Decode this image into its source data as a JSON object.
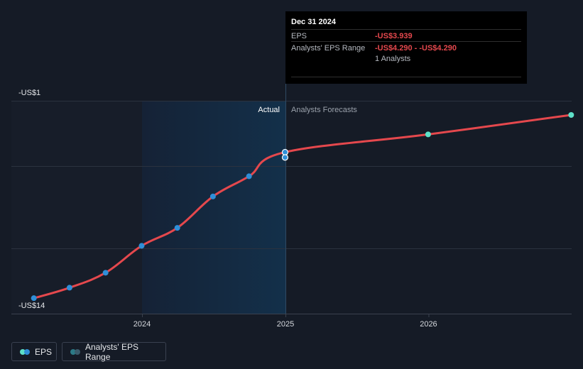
{
  "tooltip": {
    "date": "Dec 31 2024",
    "eps_label": "EPS",
    "eps_value": "-US$3.939",
    "range_label": "Analysts' EPS Range",
    "range_value": "-US$4.290 - -US$4.290",
    "analysts": "1 Analysts"
  },
  "legend": {
    "eps_label": "EPS",
    "range_label": "Analysts' EPS Range"
  },
  "colors": {
    "line": "#e5484d",
    "actual_point": "#2f8fd8",
    "forecast_point": "#5ee0c8",
    "range_dot_a": "#2c7a86",
    "range_dot_b": "#3a5b6b"
  },
  "chart_data": {
    "type": "line",
    "y_top_label": "-US$1",
    "y_bottom_label": "-US$14",
    "ylim": [
      -14,
      -1
    ],
    "x_ticks": [
      "2024",
      "2025",
      "2026"
    ],
    "section_labels": {
      "actual": "Actual",
      "forecast": "Analysts Forecasts"
    },
    "actual": [
      {
        "x": "2023-03-31",
        "y": -13.7
      },
      {
        "x": "2023-06-30",
        "y": -13.0
      },
      {
        "x": "2023-09-30",
        "y": -12.0
      },
      {
        "x": "2023-12-31",
        "y": -10.2
      },
      {
        "x": "2024-03-31",
        "y": -9.0
      },
      {
        "x": "2024-06-30",
        "y": -6.9
      },
      {
        "x": "2024-09-30",
        "y": -5.55
      },
      {
        "x": "2024-12-31",
        "y": -3.939
      }
    ],
    "forecast": [
      {
        "x": "2024-12-31",
        "y": -4.29
      },
      {
        "x": "2025-12-31",
        "y": -2.75
      },
      {
        "x": "2026-12-31",
        "y": -1.45
      }
    ],
    "analysts_range": {
      "x": "2024-12-31",
      "low": -4.29,
      "high": -4.29
    }
  }
}
